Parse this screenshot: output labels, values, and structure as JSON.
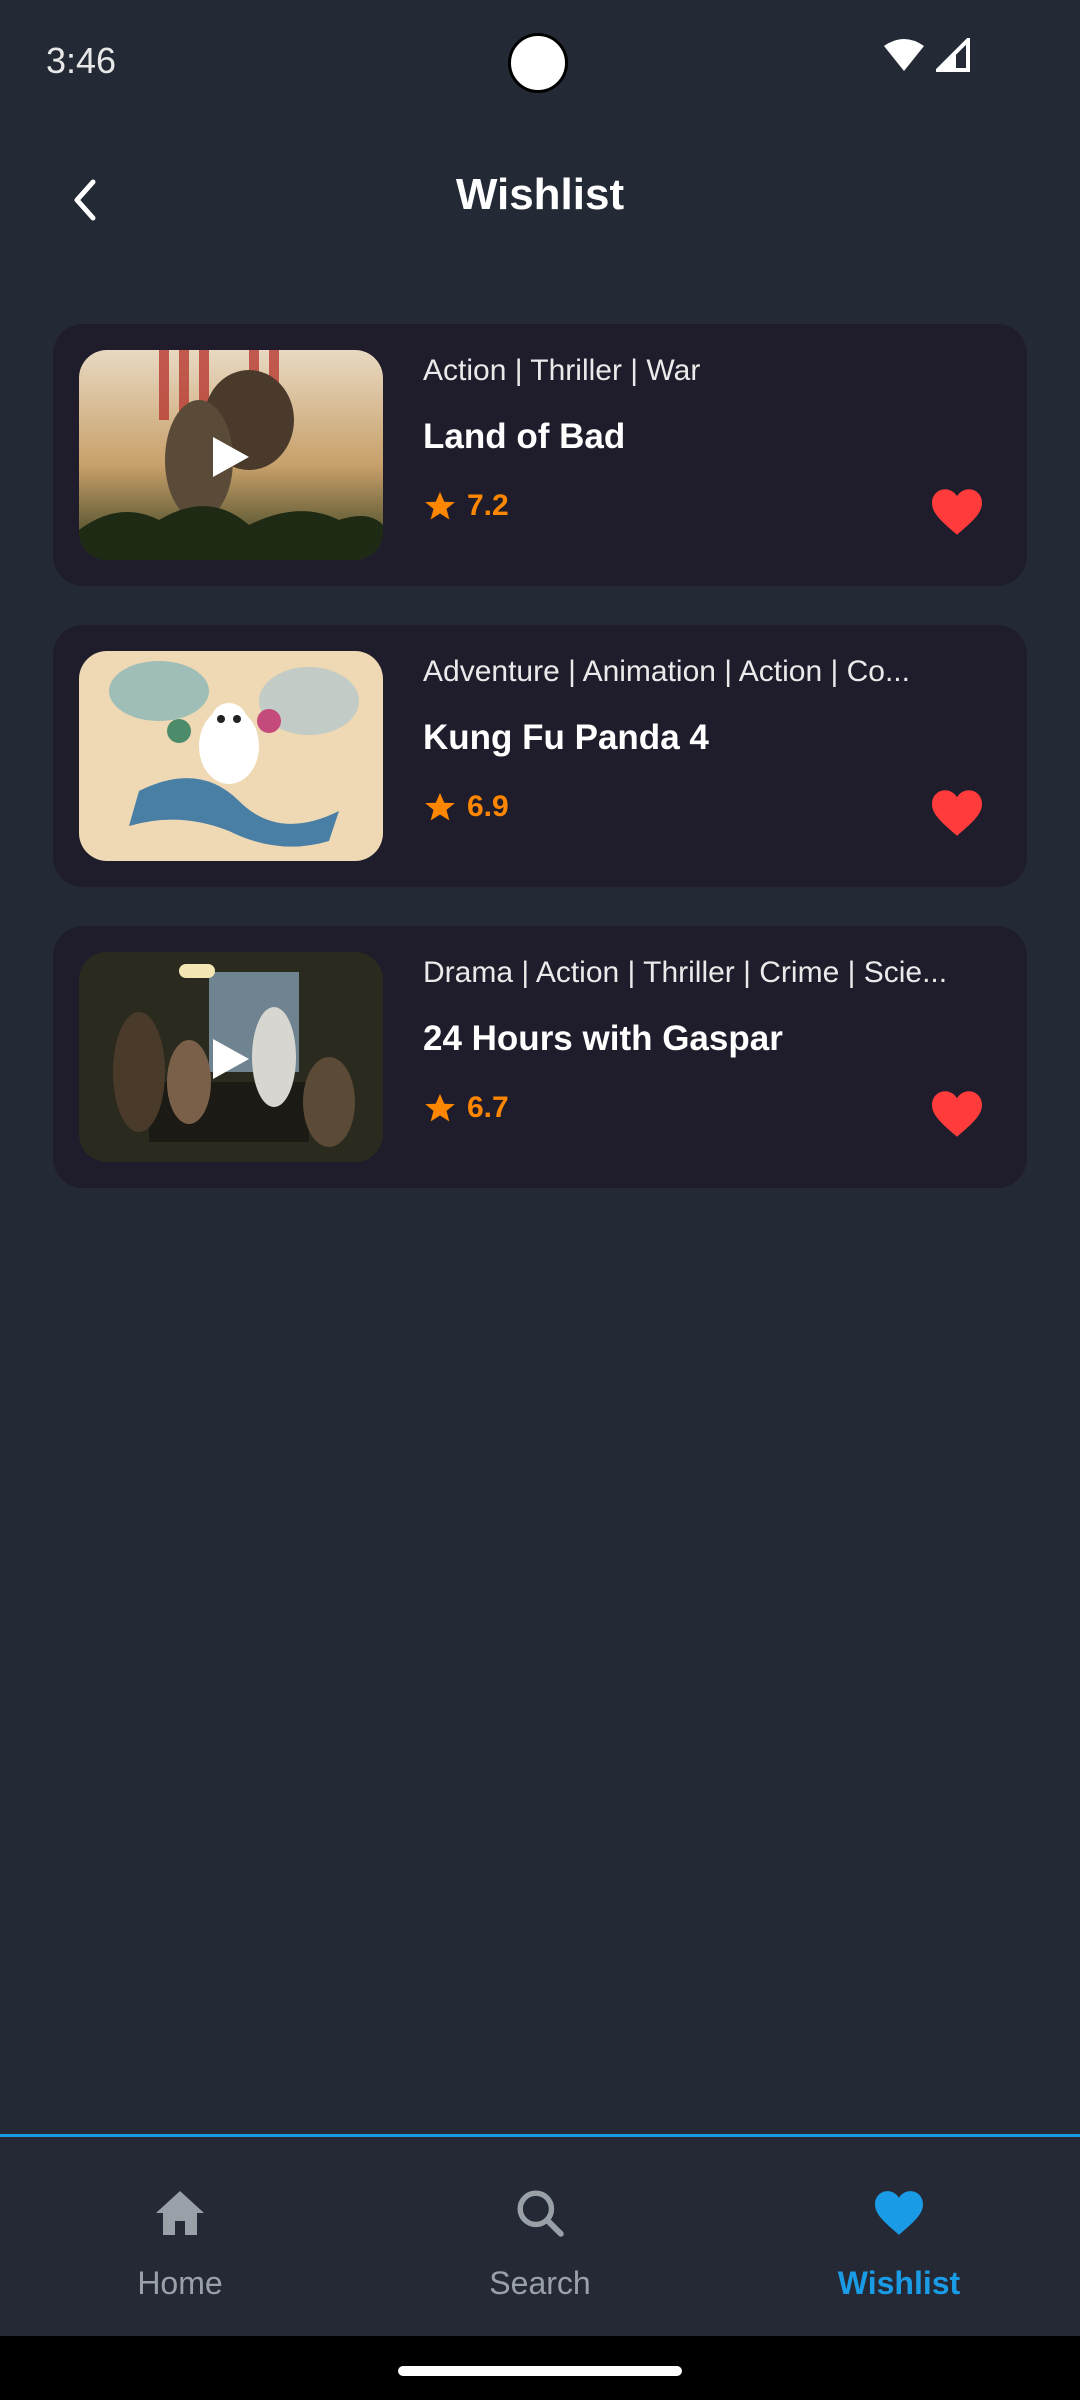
{
  "status_bar": {
    "time": "3:46"
  },
  "header": {
    "title": "Wishlist",
    "back_icon": "chevron-left-icon"
  },
  "movies": [
    {
      "genres": "Action | Thriller | War",
      "title": "Land of Bad",
      "rating": "7.2"
    },
    {
      "genres": "Adventure | Animation | Action | Co...",
      "title": "Kung Fu Panda 4",
      "rating": "6.9"
    },
    {
      "genres": "Drama | Action | Thriller | Crime | Scie...",
      "title": "24 Hours with Gaspar",
      "rating": "6.7"
    }
  ],
  "bottom_nav": {
    "items": [
      {
        "label": "Home",
        "icon": "home-icon",
        "active": false
      },
      {
        "label": "Search",
        "icon": "search-icon",
        "active": false
      },
      {
        "label": "Wishlist",
        "icon": "heart-icon",
        "active": true
      }
    ]
  },
  "colors": {
    "background": "#242a35",
    "card": "#1f1d2b",
    "accent": "#1a9be6",
    "rating": "#ff8700",
    "heart": "#ff3b3b"
  }
}
